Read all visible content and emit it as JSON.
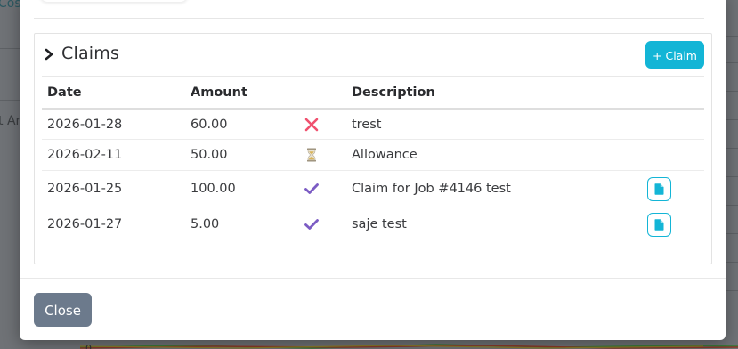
{
  "background": {
    "left_link_fragment": "Cos",
    "left_text_fragment": "t Ar",
    "chart_zero_label": "0"
  },
  "card": {
    "title": "Claims",
    "add_button_label": "+ Claim"
  },
  "table": {
    "headers": {
      "date": "Date",
      "amount": "Amount",
      "status": "",
      "description": "Description"
    },
    "rows": [
      {
        "date": "2026-01-28",
        "amount": "60.00",
        "status_icon": "cross-icon",
        "description": "trest",
        "has_document": false
      },
      {
        "date": "2026-02-11",
        "amount": "50.00",
        "status_icon": "hourglass-icon",
        "description": "Allowance",
        "has_document": false
      },
      {
        "date": "2026-01-25",
        "amount": "100.00",
        "status_icon": "check-icon",
        "description": "Claim for Job #4146 test",
        "has_document": true
      },
      {
        "date": "2026-01-27",
        "amount": "5.00",
        "status_icon": "check-icon",
        "description": "saje test",
        "has_document": true
      }
    ]
  },
  "footer": {
    "close_label": "Close"
  },
  "colors": {
    "accent": "#13b5d6",
    "close_button": "#6c7a8c",
    "reject": "#f0506e",
    "approved": "#7c5cc4",
    "pending": "#c9a84c"
  }
}
